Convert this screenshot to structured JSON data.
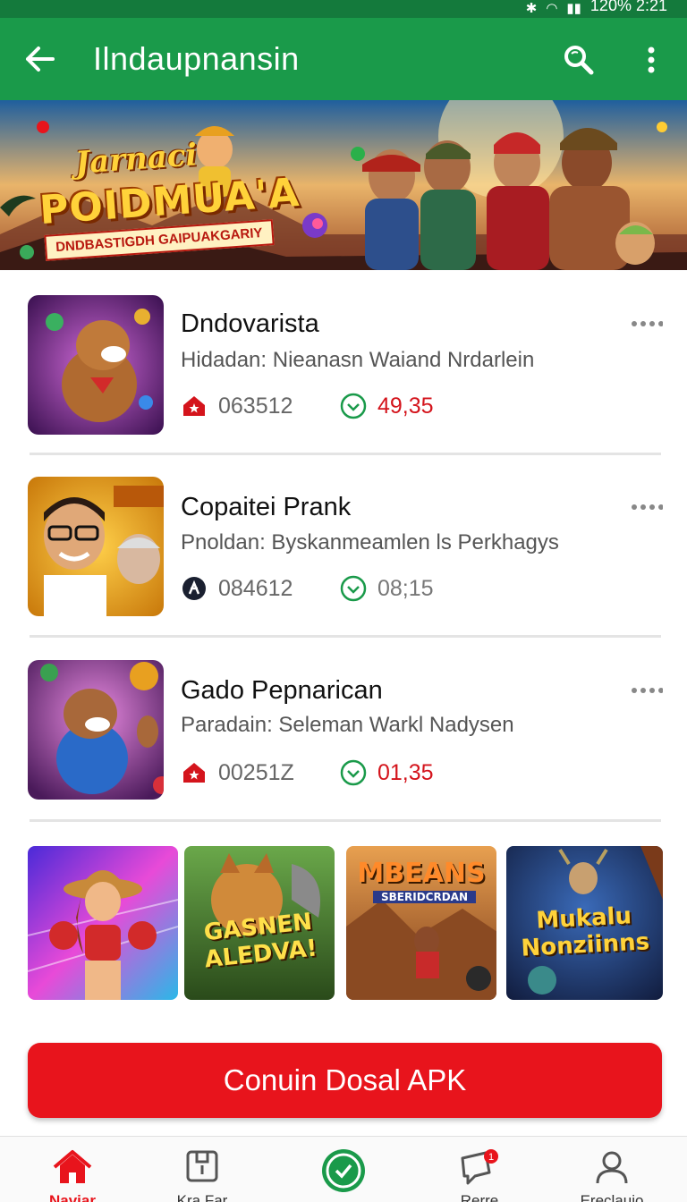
{
  "status_bar": {
    "text": "120% 2:21"
  },
  "app_bar": {
    "title": "Ilndaupnansin",
    "back_icon": "arrow-left-icon",
    "search_icon": "search-icon",
    "more_icon": "more-vertical-icon"
  },
  "banner": {
    "title_line1": "Jarnaci",
    "title_line2": "POIDMUA'A",
    "subtitle": "DNDBASTIGDH GAIPUAKGARIY"
  },
  "apps": [
    {
      "title": "Dndovarista",
      "subtitle": "Hidadan: Nieanasn Waiand Nrdarlein",
      "stat1": "063512",
      "stat2": "49,35",
      "stat1_icon": "red-home-icon",
      "stat2_icon": "check-circle-icon",
      "stat2_color": "#d4141c"
    },
    {
      "title": "Copaitei Prank",
      "subtitle": "Pnoldan: Byskanmeamlen ls Perkhagys",
      "stat1": "084612",
      "stat2": "08;15",
      "stat1_icon": "ribbon-icon",
      "stat2_icon": "check-circle-icon",
      "stat2_color": "#777777"
    },
    {
      "title": "Gado Pepnarican",
      "subtitle": "Paradain: Seleman Warkl Nadysen",
      "stat1": "00251Z",
      "stat2": "01,35",
      "stat1_icon": "red-home-icon",
      "stat2_icon": "check-circle-icon",
      "stat2_color": "#d4141c"
    }
  ],
  "tiles": [
    {
      "text": ""
    },
    {
      "text": "GASNEN ALEDVA!"
    },
    {
      "text": "MBEANS",
      "subtext": "SBERIDCRDAN"
    },
    {
      "text": "Mukalu Nonziinns"
    }
  ],
  "download_button": "Conuin Dosal APK",
  "bottom_nav": [
    {
      "label": "Naviar",
      "icon": "home-icon",
      "active": true
    },
    {
      "label": "Kra Far",
      "icon": "box-icon",
      "active": false
    },
    {
      "label": "",
      "icon": "check-circle-icon",
      "active": false
    },
    {
      "label": "Rerre",
      "icon": "chat-icon",
      "active": false,
      "badge": "1"
    },
    {
      "label": "Ereclaujo",
      "icon": "user-icon",
      "active": false
    }
  ],
  "colors": {
    "primary_green": "#1a9a4a",
    "accent_red": "#e8141c"
  }
}
